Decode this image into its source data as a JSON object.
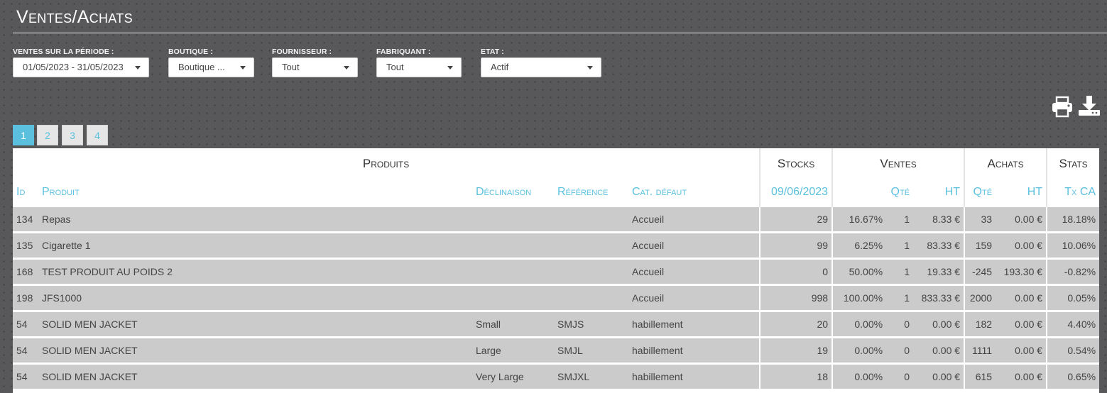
{
  "page": {
    "title": "Ventes/Achats"
  },
  "filters": [
    {
      "label": "Ventes sur la période :",
      "value": "01/05/2023 - 31/05/2023"
    },
    {
      "label": "Boutique :",
      "value": "Boutique ..."
    },
    {
      "label": "Fournisseur :",
      "value": "Tout"
    },
    {
      "label": "Fabriquant :",
      "value": "Tout"
    },
    {
      "label": "Etat :",
      "value": "Actif"
    }
  ],
  "toolbar": {
    "print_icon": "print-icon",
    "download_icon": "download-icon"
  },
  "pagination": {
    "pages": [
      "1",
      "2",
      "3",
      "4"
    ],
    "active": "1"
  },
  "table": {
    "groups": {
      "produits": "Produits",
      "stocks": "Stocks",
      "ventes": "Ventes",
      "achats": "Achats",
      "stats": "Stats"
    },
    "columns": {
      "id": "Id",
      "produit": "Produit",
      "declinaison": "Déclinaison",
      "reference": "Référence",
      "cat": "Cat. défaut",
      "stock_date": "09/06/2023",
      "ventes_qte": "Qté",
      "ventes_ht": "HT",
      "achats_qte": "Qté",
      "achats_ht": "HT",
      "tx_ca": "Tx CA"
    },
    "rows": [
      {
        "id": "134",
        "produit": "Repas",
        "declinaison": "",
        "reference": "",
        "cat": "Accueil",
        "stock": "29",
        "pct": "16.67%",
        "vqte": "1",
        "vht": "8.33 €",
        "aqte": "33",
        "aht": "0.00 €",
        "tx": "18.18%"
      },
      {
        "id": "135",
        "produit": "Cigarette 1",
        "declinaison": "",
        "reference": "",
        "cat": "Accueil",
        "stock": "99",
        "pct": "6.25%",
        "vqte": "1",
        "vht": "83.33 €",
        "aqte": "159",
        "aht": "0.00 €",
        "tx": "10.06%"
      },
      {
        "id": "168",
        "produit": "TEST PRODUIT AU POIDS 2",
        "declinaison": "",
        "reference": "",
        "cat": "Accueil",
        "stock": "0",
        "pct": "50.00%",
        "vqte": "1",
        "vht": "19.33 €",
        "aqte": "-245",
        "aht": "193.30 €",
        "tx": "-0.82%"
      },
      {
        "id": "198",
        "produit": "JFS1000",
        "declinaison": "",
        "reference": "",
        "cat": "Accueil",
        "stock": "998",
        "pct": "100.00%",
        "vqte": "1",
        "vht": "833.33 €",
        "aqte": "2000",
        "aht": "0.00 €",
        "tx": "0.05%"
      },
      {
        "id": "54",
        "produit": "SOLID MEN JACKET",
        "declinaison": "Small",
        "reference": "SMJS",
        "cat": "habillement",
        "stock": "20",
        "pct": "0.00%",
        "vqte": "0",
        "vht": "0.00 €",
        "aqte": "182",
        "aht": "0.00 €",
        "tx": "4.40%"
      },
      {
        "id": "54",
        "produit": "SOLID MEN JACKET",
        "declinaison": "Large",
        "reference": "SMJL",
        "cat": "habillement",
        "stock": "19",
        "pct": "0.00%",
        "vqte": "0",
        "vht": "0.00 €",
        "aqte": "1111",
        "aht": "0.00 €",
        "tx": "0.54%"
      },
      {
        "id": "54",
        "produit": "SOLID MEN JACKET",
        "declinaison": "Very Large",
        "reference": "SMJXL",
        "cat": "habillement",
        "stock": "18",
        "pct": "0.00%",
        "vqte": "0",
        "vht": "0.00 €",
        "aqte": "615",
        "aht": "0.00 €",
        "tx": "0.65%"
      }
    ]
  }
}
